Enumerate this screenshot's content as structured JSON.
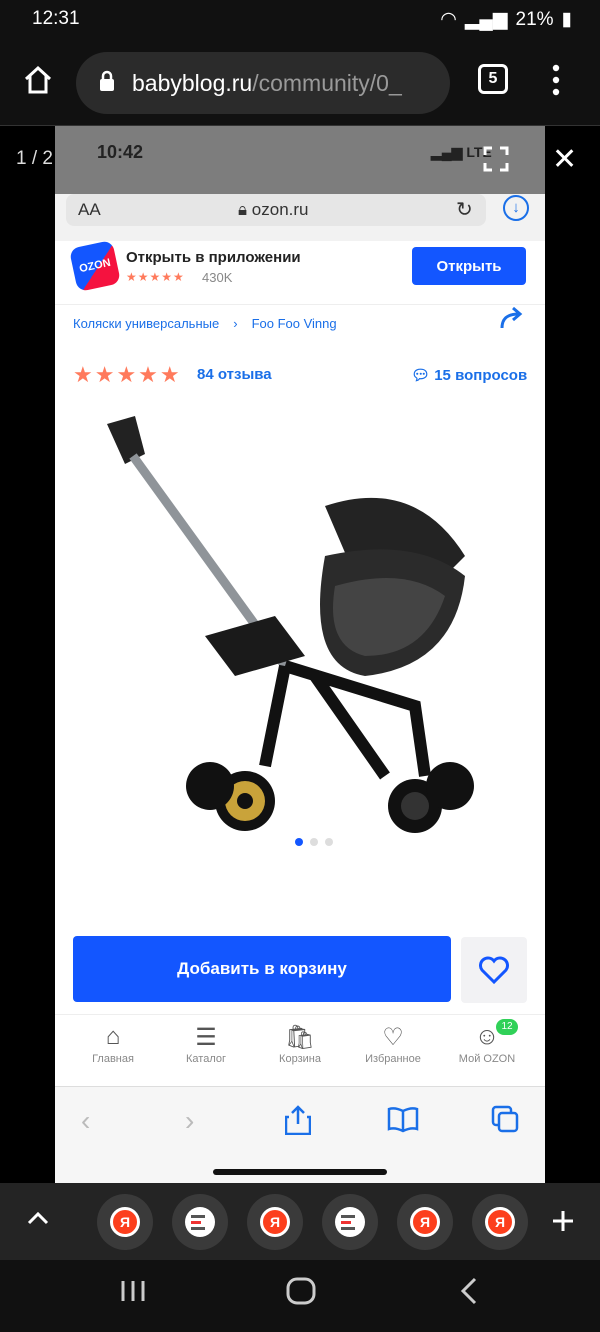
{
  "status_bar": {
    "time": "12:31",
    "battery": "21%"
  },
  "browser": {
    "url_host": "babyblog.ru",
    "url_path": "/community/0_",
    "tab_count": "5"
  },
  "viewer": {
    "counter": "1 / 2"
  },
  "screenshot": {
    "ios_time": "10:42",
    "network": "LTE",
    "safari": {
      "text_size_label": "AA",
      "domain": "ozon.ru"
    },
    "app_promo": {
      "title": "Открыть в приложении",
      "rating_count": "430K",
      "open_button": "Открыть",
      "logo_text": "OZON"
    },
    "breadcrumbs": [
      "Коляски универсальные",
      "Foo Foo Vinng"
    ],
    "rating": {
      "stars": 5,
      "reviews": "84 отзыва",
      "questions": "15 вопросов"
    },
    "carousel": {
      "total": 3,
      "active": 1
    },
    "add_to_cart": "Добавить в корзину",
    "tabs": [
      {
        "label": "Главная",
        "icon": "home-icon"
      },
      {
        "label": "Каталог",
        "icon": "catalog-icon"
      },
      {
        "label": "Корзина",
        "icon": "cart-icon"
      },
      {
        "label": "Избранное",
        "icon": "heart-icon"
      },
      {
        "label": "Мой OZON",
        "icon": "profile-icon"
      }
    ],
    "profile_badge": "12"
  },
  "thumbnail_strip": [
    {
      "icon": "yandex-icon",
      "text": "Я"
    },
    {
      "icon": "document-icon"
    },
    {
      "icon": "yandex-icon",
      "text": "Я"
    },
    {
      "icon": "document-icon"
    },
    {
      "icon": "yandex-icon",
      "text": "Я"
    },
    {
      "icon": "yandex-icon",
      "text": "Я"
    }
  ],
  "colors": {
    "ozon_blue": "#1356ff",
    "ozon_link": "#1a6fe8",
    "star": "#ff7a5c",
    "yandex_red": "#fc3f1d"
  }
}
